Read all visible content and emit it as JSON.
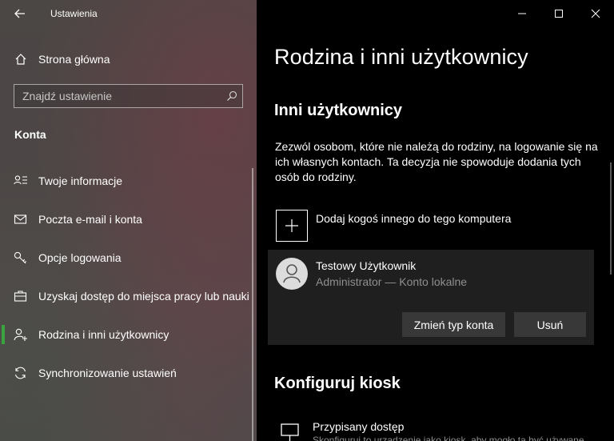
{
  "window": {
    "app_title": "Ustawienia",
    "minimize": "minimize",
    "maximize": "maximize",
    "close": "close"
  },
  "sidebar": {
    "home_label": "Strona główna",
    "search_placeholder": "Znajdź ustawienie",
    "section_label": "Konta",
    "items": [
      {
        "label": "Twoje informacje",
        "icon": "person-info-icon"
      },
      {
        "label": "Poczta e-mail i konta",
        "icon": "mail-icon"
      },
      {
        "label": "Opcje logowania",
        "icon": "key-icon"
      },
      {
        "label": "Uzyskaj dostęp do miejsca pracy lub nauki",
        "icon": "briefcase-icon"
      },
      {
        "label": "Rodzina i inni użytkownicy",
        "icon": "add-person-icon",
        "selected": true
      },
      {
        "label": "Synchronizowanie ustawień",
        "icon": "sync-icon"
      }
    ],
    "accent_color": "#3aa340"
  },
  "main": {
    "page_title": "Rodzina i inni użytkownicy",
    "other_users_heading": "Inni użytkownicy",
    "other_users_description": "Zezwól osobom, które nie należą do rodziny, na logowanie się na ich własnych kontach. Ta decyzja nie spowoduje dodania tych osób do rodziny.",
    "add_user_label": "Dodaj kogoś innego do tego komputera",
    "user": {
      "name": "Testowy Użytkownik",
      "role": "Administrator — Konto lokalne",
      "change_type_button": "Zmień typ konta",
      "remove_button": "Usuń"
    },
    "kiosk_heading": "Konfiguruj kiosk",
    "kiosk_item": {
      "title": "Przypisany dostęp",
      "description": "Skonfiguruj to urządzenie jako kiosk, aby mogło ta być używane"
    }
  }
}
